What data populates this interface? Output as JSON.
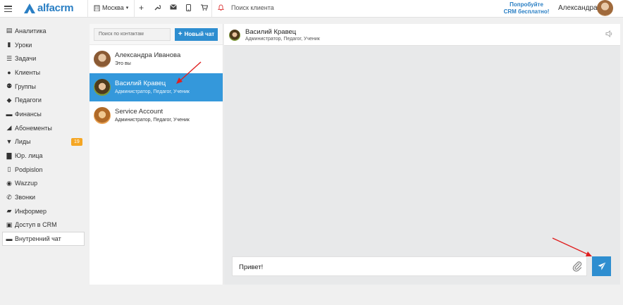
{
  "topbar": {
    "logo_text": "alfacrm",
    "branch": "Москва",
    "client_search_placeholder": "Поиск клиента",
    "promo_line1": "Попробуйте",
    "promo_line2": "CRM бесплатно!",
    "user_name": "Александра",
    "icons": [
      "menu-icon",
      "plus-icon",
      "wrench-icon",
      "envelope-icon",
      "mobile-icon",
      "cart-icon",
      "bell-icon"
    ]
  },
  "sidebar": {
    "items": [
      {
        "label": "Аналитика",
        "icon": "analytics-icon"
      },
      {
        "label": "Уроки",
        "icon": "book-icon"
      },
      {
        "label": "Задачи",
        "icon": "tasks-icon"
      },
      {
        "label": "Клиенты",
        "icon": "user-icon"
      },
      {
        "label": "Группы",
        "icon": "users-icon"
      },
      {
        "label": "Педагоги",
        "icon": "graduation-cap-icon"
      },
      {
        "label": "Финансы",
        "icon": "money-icon"
      },
      {
        "label": "Абонементы",
        "icon": "tag-icon"
      },
      {
        "label": "Лиды",
        "icon": "funnel-icon",
        "badge": "19"
      },
      {
        "label": "Юр. лица",
        "icon": "briefcase-icon"
      },
      {
        "label": "Podpislon",
        "icon": "document-icon"
      },
      {
        "label": "Wazzup",
        "icon": "whatsapp-icon"
      },
      {
        "label": "Звонки",
        "icon": "phone-icon"
      },
      {
        "label": "Информер",
        "icon": "comment-icon"
      },
      {
        "label": "Доступ в CRM",
        "icon": "lock-icon"
      },
      {
        "label": "Внутренний чат",
        "icon": "chat-icon",
        "active": true
      }
    ]
  },
  "contacts": {
    "search_placeholder": "Поиск по контактам",
    "new_chat_label": "Новый чат",
    "list": [
      {
        "name": "Александра Иванова",
        "role": "Это вы"
      },
      {
        "name": "Василий Кравец",
        "role": "Администратор, Педагог, Ученик",
        "selected": true
      },
      {
        "name": "Service Account",
        "role": "Администратор, Педагог, Ученик"
      }
    ]
  },
  "chat": {
    "name": "Василий Кравец",
    "role": "Администратор, Педагог, Ученик",
    "message_value": "Привет!"
  },
  "colors": {
    "accent": "#2e8ed0",
    "selected_row": "#3498db",
    "badge": "#f5a623",
    "annotation": "#e02020"
  }
}
